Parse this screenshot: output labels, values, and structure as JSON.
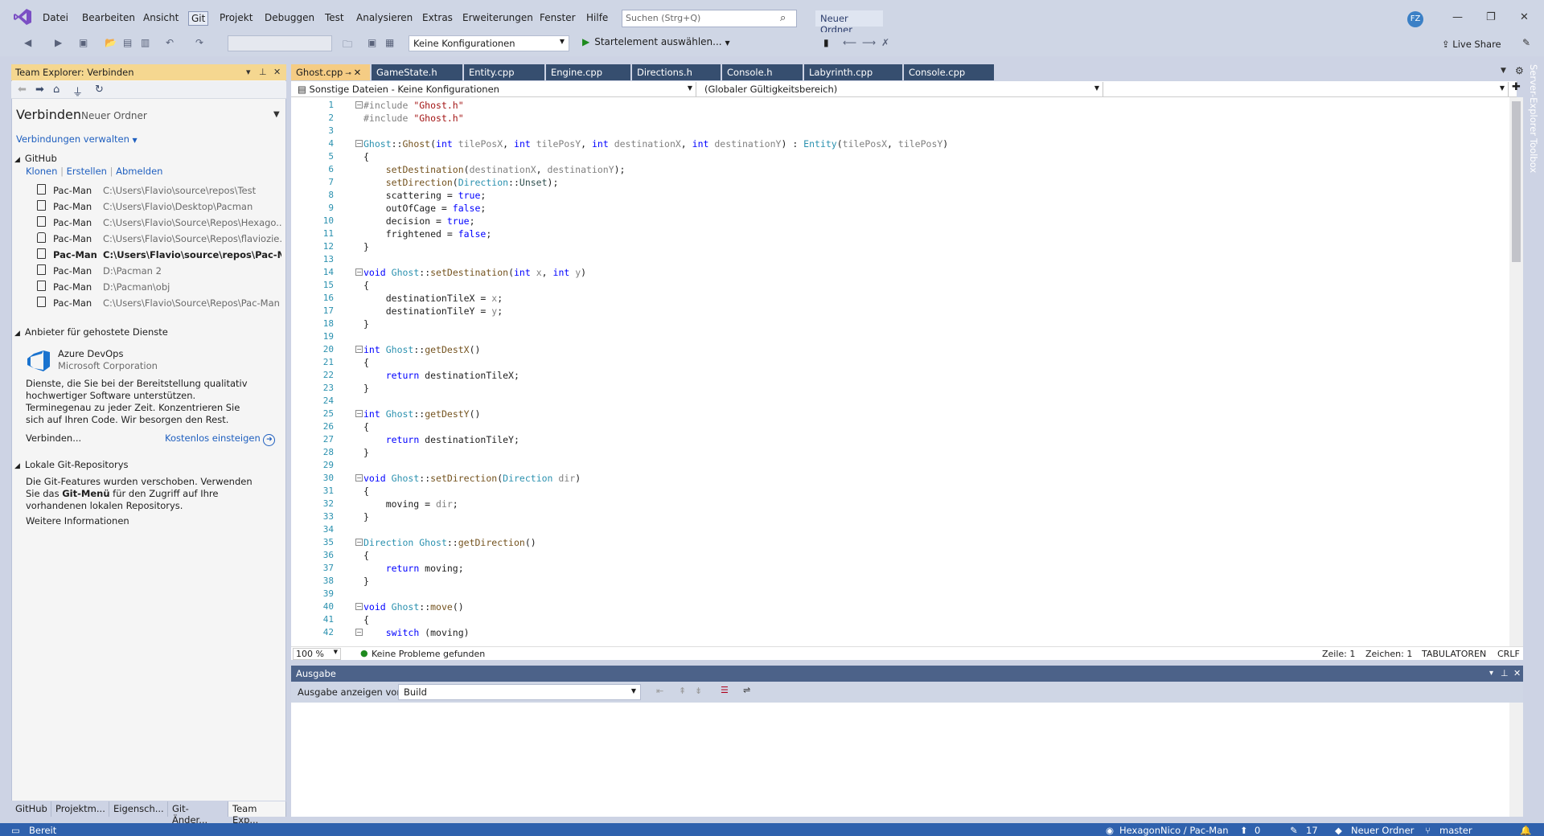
{
  "menu": {
    "items": [
      "Datei",
      "Bearbeiten",
      "Ansicht",
      "Git",
      "Projekt",
      "Debuggen",
      "Test",
      "Analysieren",
      "Extras",
      "Erweiterungen",
      "Fenster",
      "Hilfe"
    ],
    "search_placeholder": "Suchen (Strg+Q)",
    "solution_name": "Neuer Ordner",
    "avatar": "FZ"
  },
  "toolbar": {
    "config": "Keine Konfigurationen",
    "start_label": "Startelement auswählen...",
    "live_share": "Live Share"
  },
  "team_explorer": {
    "title": "Team Explorer: Verbinden",
    "heading": "Verbinden",
    "heading_sub": "Neuer Ordner",
    "manage": "Verbindungen verwalten",
    "github": {
      "label": "GitHub",
      "actions": [
        "Klonen",
        "Erstellen",
        "Abmelden"
      ],
      "repos": [
        {
          "name": "Pac-Man",
          "path": "C:\\Users\\Flavio\\source\\repos\\Test",
          "icon": "repo-icon",
          "bold": false
        },
        {
          "name": "Pac-Man",
          "path": "C:\\Users\\Flavio\\Desktop\\Pacman",
          "icon": "repo-icon",
          "bold": false
        },
        {
          "name": "Pac-Man",
          "path": "C:\\Users\\Flavio\\Source\\Repos\\Hexago...",
          "icon": "repo-icon",
          "bold": false
        },
        {
          "name": "Pac-Man",
          "path": "C:\\Users\\Flavio\\Source\\Repos\\flaviozie...",
          "icon": "lock-icon",
          "bold": false
        },
        {
          "name": "Pac-Man",
          "path": "C:\\Users\\Flavio\\source\\repos\\Pac-Ma...",
          "icon": "repo-icon",
          "bold": true
        },
        {
          "name": "Pac-Man",
          "path": "D:\\Pacman 2",
          "icon": "repo-icon",
          "bold": false
        },
        {
          "name": "Pac-Man",
          "path": "D:\\Pacman\\obj",
          "icon": "repo-icon",
          "bold": false
        },
        {
          "name": "Pac-Man",
          "path": "C:\\Users\\Flavio\\Source\\Repos\\Pac-Man",
          "icon": "repo-icon",
          "bold": false
        }
      ]
    },
    "hosted": {
      "label": "Anbieter für gehostete Dienste",
      "product": "Azure DevOps",
      "company": "Microsoft Corporation",
      "desc": "Dienste, die Sie bei der Bereitstellung qualitativ hochwertiger Software unterstützen. Terminegenau zu jeder Zeit. Konzentrieren Sie sich auf Ihren Code. Wir besorgen den Rest.",
      "connect": "Verbinden...",
      "free": "Kostenlos einsteigen"
    },
    "local": {
      "label": "Lokale Git-Repositorys",
      "text_pre": "Die Git-Features wurden verschoben. Verwenden Sie das ",
      "text_bold": "Git-Menü",
      "text_post": " für den Zugriff auf Ihre vorhandenen lokalen Repositorys.",
      "more": "Weitere Informationen"
    },
    "bottom_tabs": [
      "GitHub",
      "Projektm...",
      "Eigensch...",
      "Git-Änder...",
      "Team Exp..."
    ]
  },
  "editor": {
    "tabs": [
      "Ghost.cpp",
      "GameState.h",
      "Entity.cpp",
      "Engine.cpp",
      "Directions.h",
      "Console.h",
      "Labyrinth.cpp",
      "Console.cpp"
    ],
    "nav_left": "Sonstige Dateien - Keine Konfigurationen",
    "nav_mid": "(Globaler Gültigkeitsbereich)",
    "zoom": "100 %",
    "problems": "Keine Probleme gefunden",
    "line": "Zeile: 1",
    "char": "Zeichen: 1",
    "tabs_mode": "TABULATOREN",
    "eol": "CRLF"
  },
  "side_tabs": [
    "Server-Explorer",
    "Toolbox"
  ],
  "output": {
    "title": "Ausgabe",
    "show_from": "Ausgabe anzeigen von:",
    "source": "Build"
  },
  "status": {
    "ready": "Bereit",
    "repo": "HexagonNico / Pac-Man",
    "up": "0",
    "changes": "17",
    "folder": "Neuer Ordner",
    "branch": "master"
  }
}
